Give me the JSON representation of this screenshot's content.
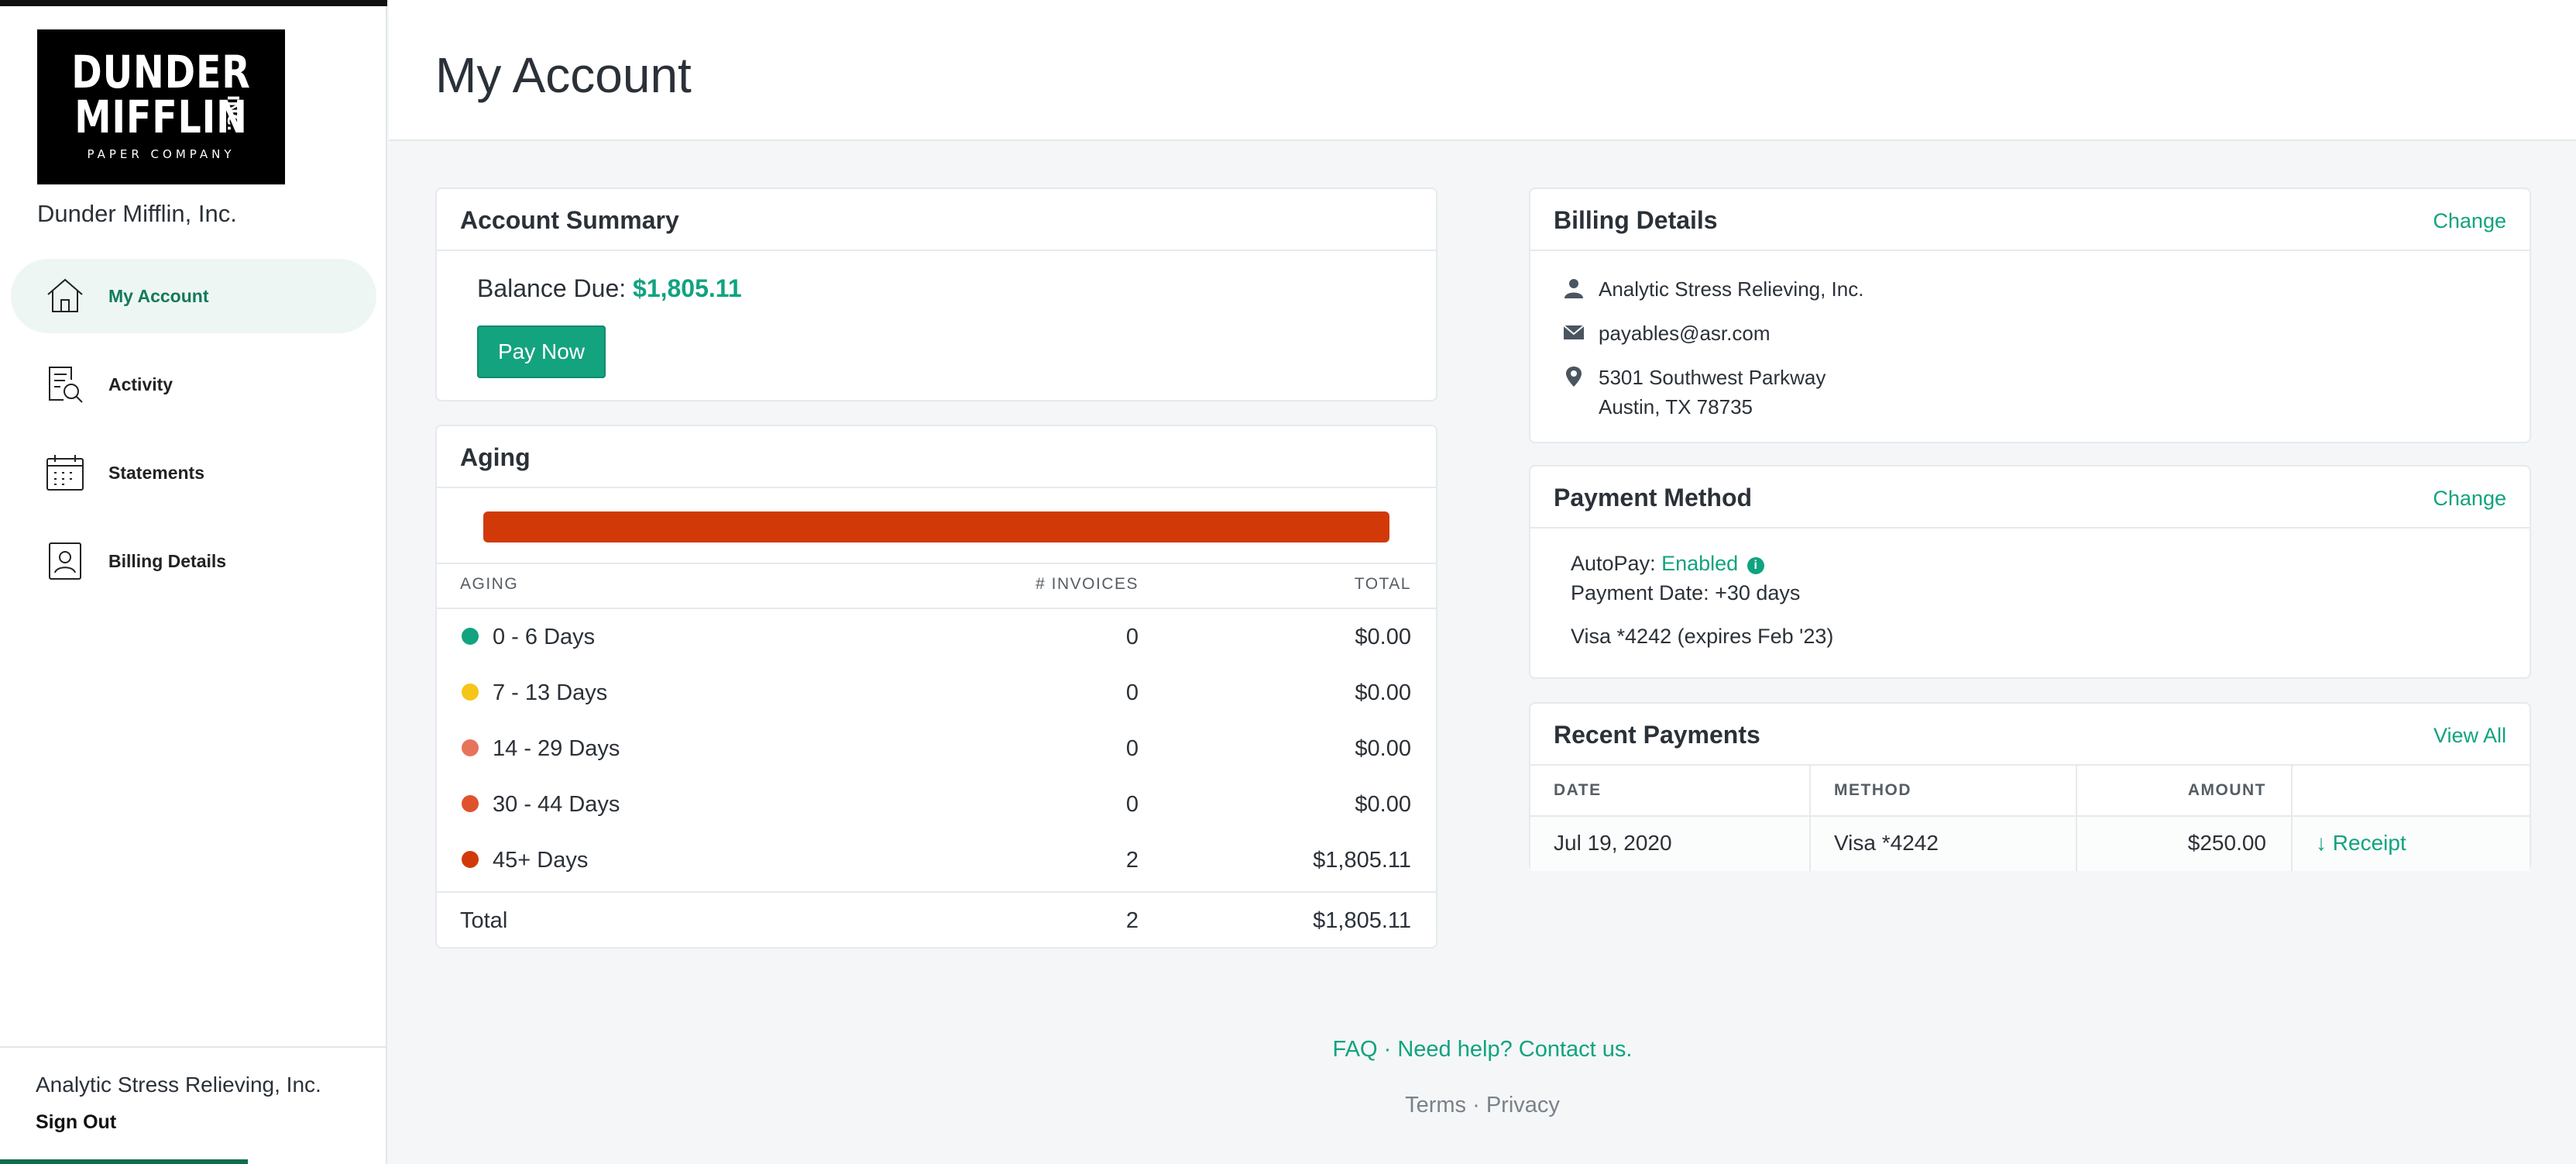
{
  "brand": {
    "logo_line1": "DUNDER",
    "logo_line2": "MIFFLIN",
    "logo_inc": "INC.",
    "logo_sub": "PAPER COMPANY",
    "company_name": "Dunder Mifflin, Inc."
  },
  "sidebar": {
    "items": [
      {
        "label": "My Account",
        "icon": "home-icon",
        "active": true
      },
      {
        "label": "Activity",
        "icon": "document-search-icon",
        "active": false
      },
      {
        "label": "Statements",
        "icon": "calendar-icon",
        "active": false
      },
      {
        "label": "Billing Details",
        "icon": "contact-card-icon",
        "active": false
      }
    ],
    "user_name": "Analytic Stress Relieving, Inc.",
    "sign_out": "Sign Out"
  },
  "header": {
    "title": "My Account"
  },
  "account_summary": {
    "title": "Account Summary",
    "balance_label": "Balance Due:",
    "balance_value": "$1,805.11",
    "pay_button": "Pay Now"
  },
  "aging": {
    "title": "Aging",
    "headers": {
      "aging": "AGING",
      "invoices": "# INVOICES",
      "total": "TOTAL"
    },
    "rows": [
      {
        "label": "0 - 6 Days",
        "count": "0",
        "total": "$0.00",
        "color": "#14a37f"
      },
      {
        "label": "7 - 13 Days",
        "count": "0",
        "total": "$0.00",
        "color": "#f5c518"
      },
      {
        "label": "14 - 29 Days",
        "count": "0",
        "total": "$0.00",
        "color": "#e8735b"
      },
      {
        "label": "30 - 44 Days",
        "count": "0",
        "total": "$0.00",
        "color": "#e0522c"
      },
      {
        "label": "45+ Days",
        "count": "2",
        "total": "$1,805.11",
        "color": "#d13a08"
      }
    ],
    "total_row": {
      "label": "Total",
      "count": "2",
      "total": "$1,805.11"
    }
  },
  "billing_details": {
    "title": "Billing Details",
    "action": "Change",
    "name": "Analytic Stress Relieving, Inc.",
    "email": "payables@asr.com",
    "address_line1": "5301 Southwest Parkway",
    "address_line2": "Austin, TX 78735"
  },
  "payment_method": {
    "title": "Payment Method",
    "action": "Change",
    "autopay_label": "AutoPay:",
    "autopay_value": "Enabled",
    "info_glyph": "i",
    "payment_date": "Payment Date: +30 days",
    "card": "Visa *4242 (expires Feb '23)"
  },
  "recent_payments": {
    "title": "Recent Payments",
    "action": "View All",
    "headers": {
      "date": "DATE",
      "method": "METHOD",
      "amount": "AMOUNT"
    },
    "rows": [
      {
        "date": "Jul 19, 2020",
        "method": "Visa *4242",
        "amount": "$250.00",
        "receipt": "↓ Receipt"
      }
    ]
  },
  "footer": {
    "faq": "FAQ",
    "sep": "·",
    "help": "Need help? Contact us.",
    "terms": "Terms",
    "privacy": "Privacy"
  },
  "colors": {
    "accent": "#10a37f",
    "aging_bar": "#d13a08"
  }
}
